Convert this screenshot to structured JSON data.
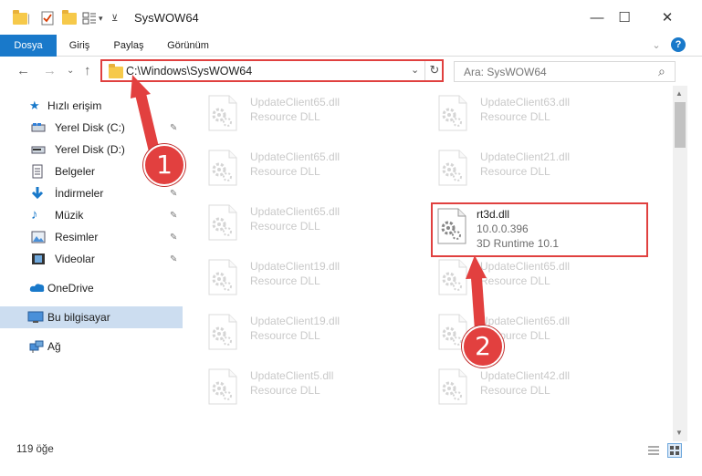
{
  "window": {
    "title": "SysWOW64",
    "minimize_glyph": "—",
    "maximize_glyph": "☐",
    "close_glyph": "✕"
  },
  "ribbon": {
    "tabs": [
      "Dosya",
      "Giriş",
      "Paylaş",
      "Görünüm"
    ],
    "collapse_glyph": "⌄",
    "help_glyph": "?"
  },
  "address": {
    "path": "C:\\Windows\\SysWOW64",
    "search_placeholder": "Ara: SysWOW64",
    "back_glyph": "←",
    "forward_glyph": "→",
    "recent_glyph": "⌄",
    "up_glyph": "↑",
    "dropdown_glyph": "⌄",
    "refresh_glyph": "↻",
    "search_glyph": "⌕"
  },
  "sidebar": {
    "quick_access": "Hızlı erişim",
    "items": [
      {
        "label": "Yerel Disk (C:)",
        "icon": "drive-icon"
      },
      {
        "label": "Yerel Disk (D:)",
        "icon": "drive-icon"
      },
      {
        "label": "Belgeler",
        "icon": "documents-icon"
      },
      {
        "label": "İndirmeler",
        "icon": "downloads-icon"
      },
      {
        "label": "Müzik",
        "icon": "music-icon"
      },
      {
        "label": "Resimler",
        "icon": "pictures-icon"
      },
      {
        "label": "Videolar",
        "icon": "videos-icon"
      }
    ],
    "onedrive": "OneDrive",
    "this_pc": "Bu bilgisayar",
    "network": "Ağ",
    "pin_glyph": "✎",
    "expand_glyph": "›"
  },
  "files": {
    "left": [
      {
        "name": "UpdateClient65.dll",
        "type": "Resource DLL"
      },
      {
        "name": "UpdateClient65.dll",
        "type": "Resource DLL"
      },
      {
        "name": "UpdateClient65.dll",
        "type": "Resource DLL"
      },
      {
        "name": "UpdateClient19.dll",
        "type": "Resource DLL"
      },
      {
        "name": "UpdateClient19.dll",
        "type": "Resource DLL"
      },
      {
        "name": "UpdateClient5.dll",
        "type": "Resource DLL"
      }
    ],
    "right": [
      {
        "name": "UpdateClient63.dll",
        "type": "Resource DLL"
      },
      {
        "name": "UpdateClient21.dll",
        "type": "Resource DLL"
      },
      {
        "name": "UpdateClient65.dll",
        "type": "Resource DLL"
      },
      {
        "name": "UpdateClient65.dll",
        "type": "Resource DLL"
      },
      {
        "name": "UpdateClient42.dll",
        "type": "Resource DLL"
      }
    ],
    "highlighted": {
      "name": "rt3d.dll",
      "version": "10.0.0.396",
      "description": "3D Runtime 10.1"
    }
  },
  "scrollbar": {
    "up_glyph": "▲",
    "down_glyph": "▼"
  },
  "status": {
    "count": "119 öğe"
  },
  "callouts": [
    "1",
    "2"
  ],
  "colors": {
    "accent": "#1979ca",
    "callout_red": "#e2403f",
    "selection": "#ccddf0"
  }
}
